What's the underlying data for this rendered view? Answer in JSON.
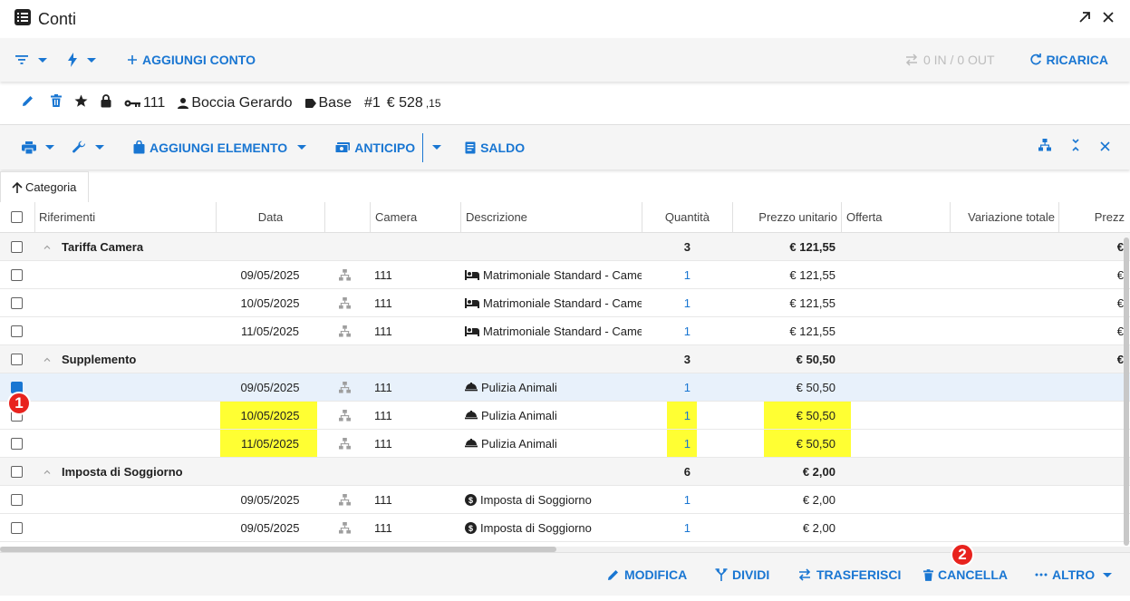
{
  "window": {
    "title": "Conti"
  },
  "toolbar1": {
    "add_account": "AGGIUNGI CONTO",
    "io_status": "0 IN / 0 OUT",
    "reload": "RICARICA"
  },
  "account": {
    "room": "111",
    "guest": "Boccia Gerardo",
    "tag": "Base",
    "number": "#1",
    "amount_main": "€ 528",
    "amount_cents": ",15"
  },
  "toolbar2": {
    "add_item": "AGGIUNGI ELEMENTO",
    "advance": "ANTICIPO",
    "balance": "SALDO"
  },
  "category_chip": "Categoria",
  "columns": {
    "riferimenti": "Riferimenti",
    "data": "Data",
    "camera": "Camera",
    "descrizione": "Descrizione",
    "quantita": "Quantità",
    "prezzo_unitario": "Prezzo unitario",
    "offerta": "Offerta",
    "variazione_totale": "Variazione totale",
    "prezzo": "Prezz"
  },
  "groups": [
    {
      "name": "Tariffa Camera",
      "quantity": "3",
      "unit_price": "€ 121,55",
      "price": "€",
      "rows": [
        {
          "date": "09/05/2025",
          "room": "111",
          "description": "Matrimoniale Standard - Came",
          "quantity": "1",
          "unit_price": "€ 121,55",
          "price": "€"
        },
        {
          "date": "10/05/2025",
          "room": "111",
          "description": "Matrimoniale Standard - Came",
          "quantity": "1",
          "unit_price": "€ 121,55",
          "price": "€"
        },
        {
          "date": "11/05/2025",
          "room": "111",
          "description": "Matrimoniale Standard - Came",
          "quantity": "1",
          "unit_price": "€ 121,55",
          "price": "€"
        }
      ]
    },
    {
      "name": "Supplemento",
      "quantity": "3",
      "unit_price": "€ 50,50",
      "price": "€",
      "rows": [
        {
          "date": "09/05/2025",
          "room": "111",
          "description": "Pulizia Animali",
          "quantity": "1",
          "unit_price": "€ 50,50",
          "price": ""
        },
        {
          "date": "10/05/2025",
          "room": "111",
          "description": "Pulizia Animali",
          "quantity": "1",
          "unit_price": "€ 50,50",
          "price": ""
        },
        {
          "date": "11/05/2025",
          "room": "111",
          "description": "Pulizia Animali",
          "quantity": "1",
          "unit_price": "€ 50,50",
          "price": ""
        }
      ]
    },
    {
      "name": "Imposta di Soggiorno",
      "quantity": "6",
      "unit_price": "€ 2,00",
      "price": "",
      "rows": [
        {
          "date": "09/05/2025",
          "room": "111",
          "description": "Imposta di Soggiorno",
          "quantity": "1",
          "unit_price": "€ 2,00",
          "price": ""
        },
        {
          "date": "09/05/2025",
          "room": "111",
          "description": "Imposta di Soggiorno",
          "quantity": "1",
          "unit_price": "€ 2,00",
          "price": ""
        }
      ]
    }
  ],
  "footer": {
    "edit": "MODIFICA",
    "split": "DIVIDI",
    "transfer": "TRASFERISCI",
    "delete": "CANCELLA",
    "more": "ALTRO"
  },
  "annotations": {
    "badge1": "1",
    "badge2": "2"
  },
  "colors": {
    "accent": "#1976d2",
    "highlight": "#ffff33",
    "badge": "#e8231e"
  }
}
